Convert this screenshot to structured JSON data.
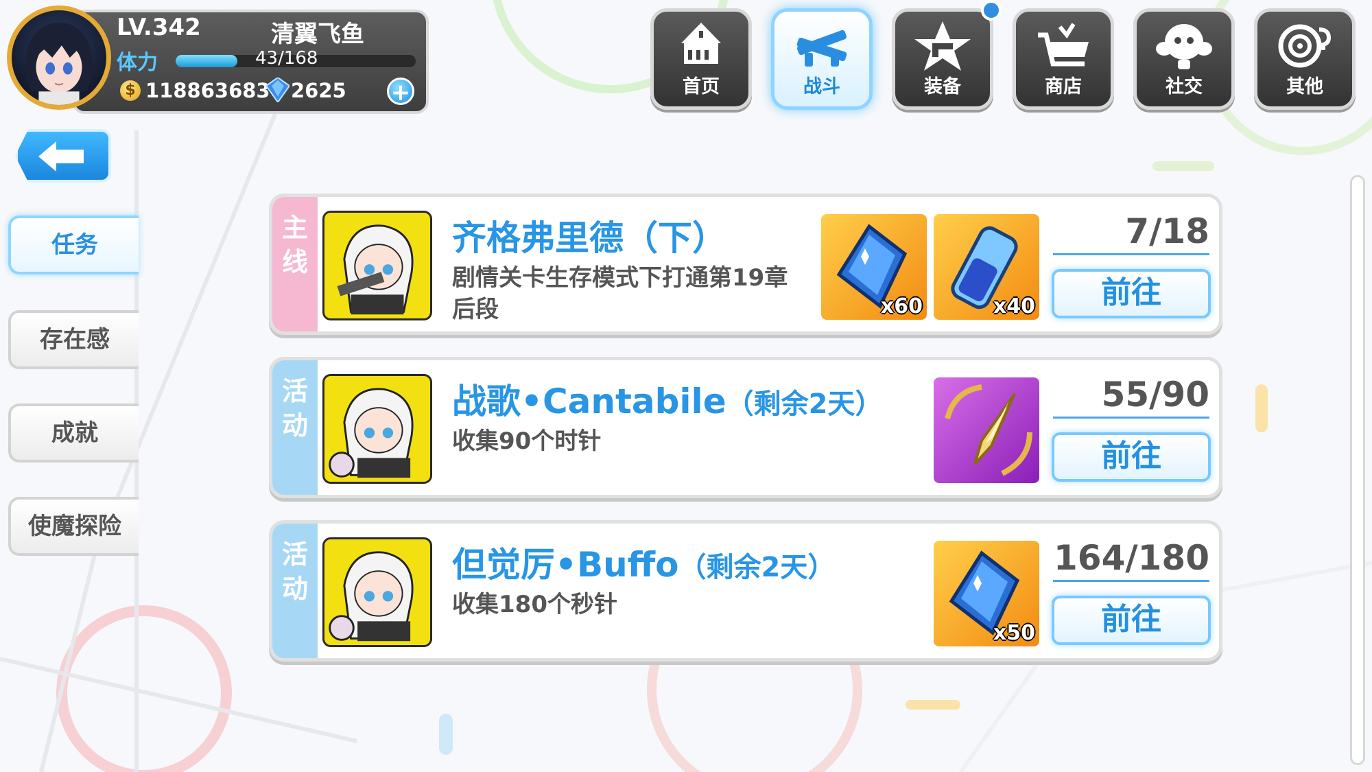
{
  "player": {
    "level": "LV.342",
    "name": "清翼飞鱼",
    "stamina_label": "体力",
    "stamina_text": "43/168",
    "stamina_fraction": 0.256,
    "gold": "118863683",
    "gems": "2625"
  },
  "nav": {
    "items": [
      {
        "label": "首页",
        "icon": "home-icon"
      },
      {
        "label": "战斗",
        "icon": "battle-icon"
      },
      {
        "label": "装备",
        "icon": "equipment-icon"
      },
      {
        "label": "商店",
        "icon": "shop-icon"
      },
      {
        "label": "社交",
        "icon": "social-icon"
      },
      {
        "label": "其他",
        "icon": "other-icon"
      }
    ],
    "active_index": 1
  },
  "sidebar": {
    "items": [
      {
        "label": "任务"
      },
      {
        "label": "存在感"
      },
      {
        "label": "成就"
      },
      {
        "label": "使魔探险"
      }
    ],
    "active_index": 0
  },
  "tasks": [
    {
      "tag": "主线",
      "title": "齐格弗里德（下）",
      "subtitle": "",
      "desc": "剧情关卡生存模式下打通第19章后段",
      "rewards": [
        {
          "icon": "diamond-icon",
          "qty": "x60"
        },
        {
          "icon": "stamina-battery-icon",
          "qty": "x40"
        }
      ],
      "progress": "7/18",
      "button": "前往"
    },
    {
      "tag": "活动",
      "title": "战歌•Cantabile",
      "subtitle": "（剩余2天）",
      "desc": "收集90个时针",
      "rewards": [
        {
          "icon": "clock-hand-icon",
          "qty": ""
        }
      ],
      "progress": "55/90",
      "button": "前往"
    },
    {
      "tag": "活动",
      "title": "但觉厉•Buffo",
      "subtitle": "（剩余2天）",
      "desc": "收集180个秒针",
      "rewards": [
        {
          "icon": "diamond-icon",
          "qty": "x50"
        }
      ],
      "progress": "164/180",
      "button": "前往"
    }
  ],
  "colors": {
    "accent": "#2895e5",
    "main_tag": "#f5b8d0",
    "event_tag": "#a6d8f6",
    "gold_frame": "#e5a935"
  }
}
